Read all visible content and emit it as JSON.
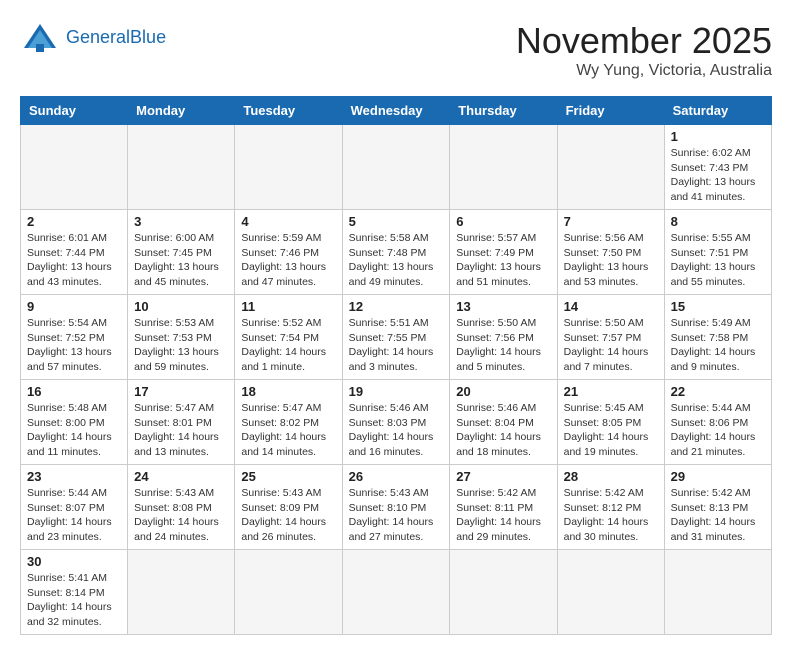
{
  "header": {
    "logo_general": "General",
    "logo_blue": "Blue",
    "month_title": "November 2025",
    "subtitle": "Wy Yung, Victoria, Australia"
  },
  "weekdays": [
    "Sunday",
    "Monday",
    "Tuesday",
    "Wednesday",
    "Thursday",
    "Friday",
    "Saturday"
  ],
  "weeks": [
    [
      {
        "day": "",
        "info": ""
      },
      {
        "day": "",
        "info": ""
      },
      {
        "day": "",
        "info": ""
      },
      {
        "day": "",
        "info": ""
      },
      {
        "day": "",
        "info": ""
      },
      {
        "day": "",
        "info": ""
      },
      {
        "day": "1",
        "info": "Sunrise: 6:02 AM\nSunset: 7:43 PM\nDaylight: 13 hours\nand 41 minutes."
      }
    ],
    [
      {
        "day": "2",
        "info": "Sunrise: 6:01 AM\nSunset: 7:44 PM\nDaylight: 13 hours\nand 43 minutes."
      },
      {
        "day": "3",
        "info": "Sunrise: 6:00 AM\nSunset: 7:45 PM\nDaylight: 13 hours\nand 45 minutes."
      },
      {
        "day": "4",
        "info": "Sunrise: 5:59 AM\nSunset: 7:46 PM\nDaylight: 13 hours\nand 47 minutes."
      },
      {
        "day": "5",
        "info": "Sunrise: 5:58 AM\nSunset: 7:48 PM\nDaylight: 13 hours\nand 49 minutes."
      },
      {
        "day": "6",
        "info": "Sunrise: 5:57 AM\nSunset: 7:49 PM\nDaylight: 13 hours\nand 51 minutes."
      },
      {
        "day": "7",
        "info": "Sunrise: 5:56 AM\nSunset: 7:50 PM\nDaylight: 13 hours\nand 53 minutes."
      },
      {
        "day": "8",
        "info": "Sunrise: 5:55 AM\nSunset: 7:51 PM\nDaylight: 13 hours\nand 55 minutes."
      }
    ],
    [
      {
        "day": "9",
        "info": "Sunrise: 5:54 AM\nSunset: 7:52 PM\nDaylight: 13 hours\nand 57 minutes."
      },
      {
        "day": "10",
        "info": "Sunrise: 5:53 AM\nSunset: 7:53 PM\nDaylight: 13 hours\nand 59 minutes."
      },
      {
        "day": "11",
        "info": "Sunrise: 5:52 AM\nSunset: 7:54 PM\nDaylight: 14 hours\nand 1 minute."
      },
      {
        "day": "12",
        "info": "Sunrise: 5:51 AM\nSunset: 7:55 PM\nDaylight: 14 hours\nand 3 minutes."
      },
      {
        "day": "13",
        "info": "Sunrise: 5:50 AM\nSunset: 7:56 PM\nDaylight: 14 hours\nand 5 minutes."
      },
      {
        "day": "14",
        "info": "Sunrise: 5:50 AM\nSunset: 7:57 PM\nDaylight: 14 hours\nand 7 minutes."
      },
      {
        "day": "15",
        "info": "Sunrise: 5:49 AM\nSunset: 7:58 PM\nDaylight: 14 hours\nand 9 minutes."
      }
    ],
    [
      {
        "day": "16",
        "info": "Sunrise: 5:48 AM\nSunset: 8:00 PM\nDaylight: 14 hours\nand 11 minutes."
      },
      {
        "day": "17",
        "info": "Sunrise: 5:47 AM\nSunset: 8:01 PM\nDaylight: 14 hours\nand 13 minutes."
      },
      {
        "day": "18",
        "info": "Sunrise: 5:47 AM\nSunset: 8:02 PM\nDaylight: 14 hours\nand 14 minutes."
      },
      {
        "day": "19",
        "info": "Sunrise: 5:46 AM\nSunset: 8:03 PM\nDaylight: 14 hours\nand 16 minutes."
      },
      {
        "day": "20",
        "info": "Sunrise: 5:46 AM\nSunset: 8:04 PM\nDaylight: 14 hours\nand 18 minutes."
      },
      {
        "day": "21",
        "info": "Sunrise: 5:45 AM\nSunset: 8:05 PM\nDaylight: 14 hours\nand 19 minutes."
      },
      {
        "day": "22",
        "info": "Sunrise: 5:44 AM\nSunset: 8:06 PM\nDaylight: 14 hours\nand 21 minutes."
      }
    ],
    [
      {
        "day": "23",
        "info": "Sunrise: 5:44 AM\nSunset: 8:07 PM\nDaylight: 14 hours\nand 23 minutes."
      },
      {
        "day": "24",
        "info": "Sunrise: 5:43 AM\nSunset: 8:08 PM\nDaylight: 14 hours\nand 24 minutes."
      },
      {
        "day": "25",
        "info": "Sunrise: 5:43 AM\nSunset: 8:09 PM\nDaylight: 14 hours\nand 26 minutes."
      },
      {
        "day": "26",
        "info": "Sunrise: 5:43 AM\nSunset: 8:10 PM\nDaylight: 14 hours\nand 27 minutes."
      },
      {
        "day": "27",
        "info": "Sunrise: 5:42 AM\nSunset: 8:11 PM\nDaylight: 14 hours\nand 29 minutes."
      },
      {
        "day": "28",
        "info": "Sunrise: 5:42 AM\nSunset: 8:12 PM\nDaylight: 14 hours\nand 30 minutes."
      },
      {
        "day": "29",
        "info": "Sunrise: 5:42 AM\nSunset: 8:13 PM\nDaylight: 14 hours\nand 31 minutes."
      }
    ],
    [
      {
        "day": "30",
        "info": "Sunrise: 5:41 AM\nSunset: 8:14 PM\nDaylight: 14 hours\nand 32 minutes."
      },
      {
        "day": "",
        "info": ""
      },
      {
        "day": "",
        "info": ""
      },
      {
        "day": "",
        "info": ""
      },
      {
        "day": "",
        "info": ""
      },
      {
        "day": "",
        "info": ""
      },
      {
        "day": "",
        "info": ""
      }
    ]
  ]
}
